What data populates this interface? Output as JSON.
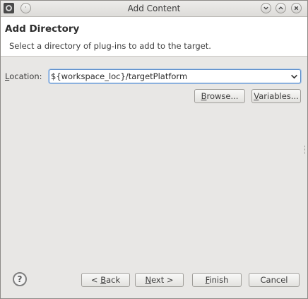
{
  "window": {
    "title": "Add Content"
  },
  "header": {
    "title": "Add Directory",
    "description": "Select a directory of plug-ins to add to the target."
  },
  "location": {
    "label_mnemonic": "L",
    "label_rest": "ocation:",
    "value": "${workspace_loc}/targetPlatform"
  },
  "buttons": {
    "browse": {
      "mnemonic": "B",
      "rest": "rowse..."
    },
    "variables": {
      "mnemonic": "V",
      "rest": "ariables..."
    },
    "back": {
      "prefix": "< ",
      "mnemonic": "B",
      "rest": "ack"
    },
    "next": {
      "mnemonic": "N",
      "rest": "ext >"
    },
    "finish": {
      "mnemonic": "F",
      "rest": "inish"
    },
    "cancel": {
      "label": "Cancel"
    }
  },
  "icons": {
    "app": "eclipse-icon",
    "menu": "window-menu-icon",
    "minimize": "chevron-down-icon",
    "maximize": "chevron-up-icon",
    "close": "close-icon",
    "help": "help-icon",
    "dropdown": "chevron-down-icon"
  },
  "help_glyph": "?"
}
